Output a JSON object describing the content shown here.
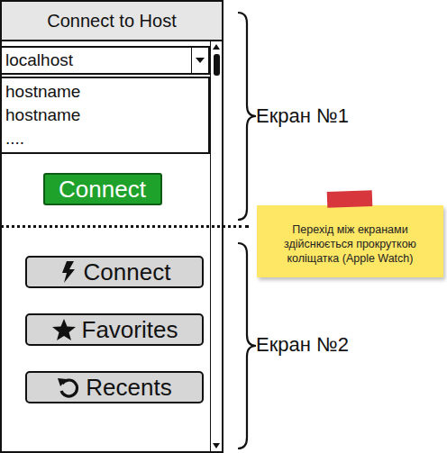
{
  "window": {
    "title": "Connect to Host"
  },
  "screen1": {
    "host_field": {
      "value": "localhost"
    },
    "host_list": [
      "hostname",
      "hostname",
      "...."
    ],
    "connect_button": "Connect"
  },
  "screen2": {
    "buttons": [
      {
        "label": "Connect",
        "kind": "connect"
      },
      {
        "label": "Favorites",
        "kind": "favorites"
      },
      {
        "label": "Recents",
        "kind": "recents"
      }
    ]
  },
  "annotations": {
    "screens": [
      {
        "label": "Екран №1"
      },
      {
        "label": "Екран №2"
      }
    ],
    "note": "Перехід між екранами здійснюється прокруткою коліщатка (Apple Watch)"
  }
}
